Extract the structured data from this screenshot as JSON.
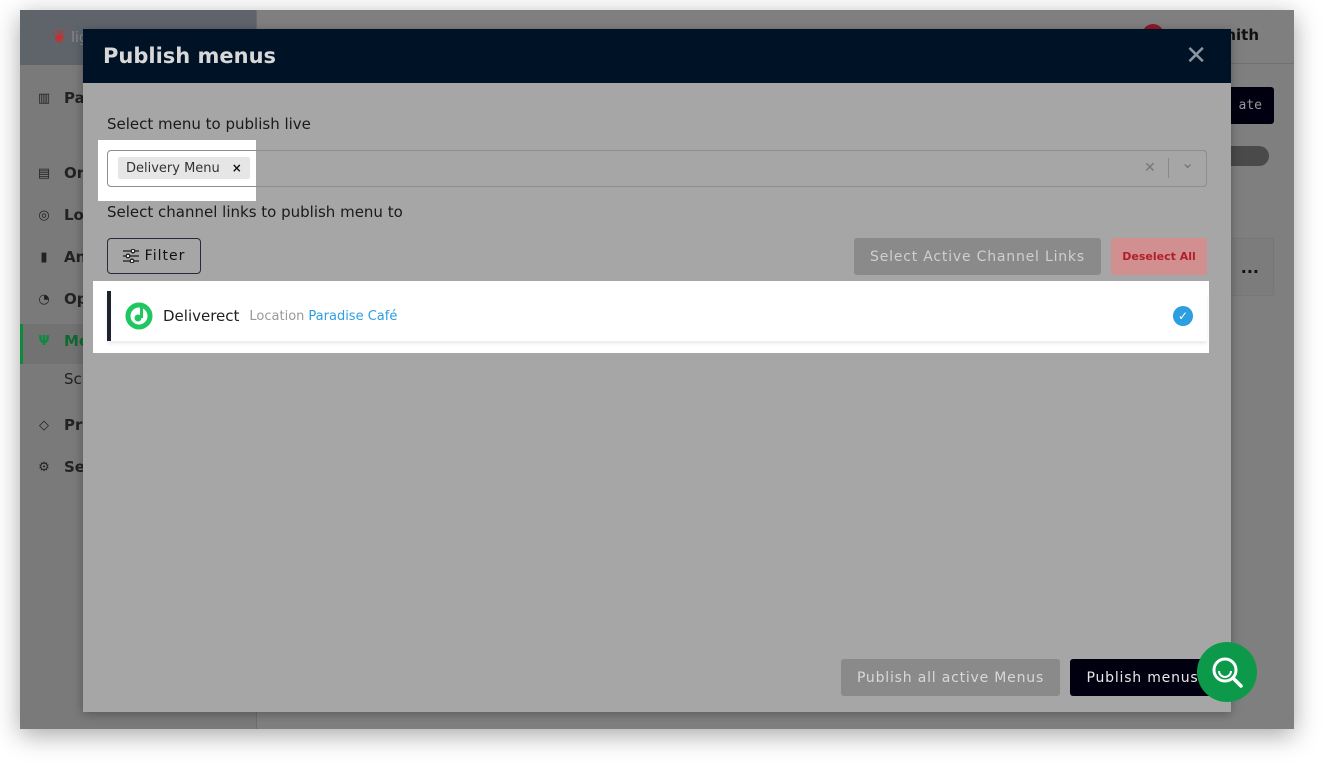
{
  "background": {
    "logo_text": "lightspeed",
    "user_name_fragment": "nith",
    "create_button_fragment": "ate",
    "card_more": "...",
    "sidebar": [
      {
        "icon": "building-icon",
        "label": "Pa",
        "glyph": "▥"
      },
      {
        "icon": "receipt-icon",
        "label": "Or",
        "glyph": "▤"
      },
      {
        "icon": "location-pin-icon",
        "label": "Lo",
        "glyph": "◎"
      },
      {
        "icon": "bar-chart-icon",
        "label": "An",
        "glyph": "▮"
      },
      {
        "icon": "gauge-icon",
        "label": "Op",
        "glyph": "◔"
      },
      {
        "icon": "fork-knife-icon",
        "label": "Me",
        "glyph": "Ψ"
      },
      {
        "icon": "",
        "label": "Sc",
        "glyph": ""
      },
      {
        "icon": "tag-icon",
        "label": "Pr",
        "glyph": "◇"
      },
      {
        "icon": "gear-icon",
        "label": "Se",
        "glyph": "⚙"
      }
    ]
  },
  "modal": {
    "title": "Publish menus",
    "close_glyph": "✕",
    "menu_label": "Select menu to publish live",
    "selected_menu": "Delivery Menu",
    "tag_remove": "×",
    "clear_glyph": "✕",
    "dropdown_glyph": "⌄",
    "channel_label": "Select channel links to publish menu to",
    "filter_label": "Filter",
    "select_active_label": "Select Active Channel Links",
    "deselect_all_label": "Deselect All",
    "channel_links": [
      {
        "name": "Deliverect",
        "location_label": "Location",
        "location": "Paradise Café",
        "selected": true
      }
    ],
    "publish_all_label": "Publish all active Menus",
    "publish_label": "Publish menus"
  },
  "colors": {
    "header": "#001226",
    "brand_green": "#0c9a4a",
    "link_blue": "#2d9ee0",
    "danger": "#b0202a"
  }
}
